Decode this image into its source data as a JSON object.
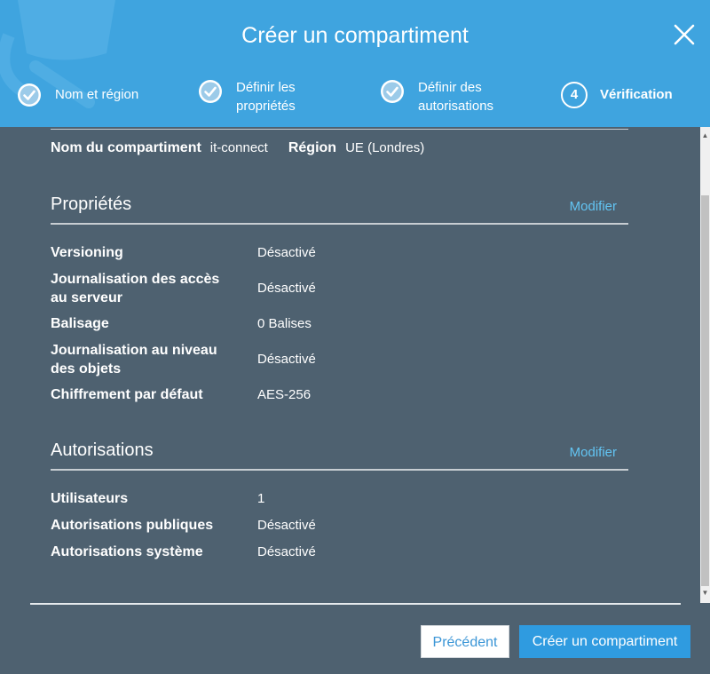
{
  "dialog": {
    "title": "Créer un compartiment",
    "close_icon": "close-icon"
  },
  "steps": [
    {
      "label_line1": "Nom et région",
      "label_line2": "",
      "state": "complete",
      "icon": "check-circle-icon"
    },
    {
      "label_line1": "Définir les",
      "label_line2": "propriétés",
      "state": "complete",
      "icon": "check-circle-icon"
    },
    {
      "label_line1": "Définir des",
      "label_line2": "autorisations",
      "state": "complete",
      "icon": "check-circle-icon"
    },
    {
      "number": "4",
      "label_line1": "Vérification",
      "label_line2": "",
      "state": "current"
    }
  ],
  "summary": {
    "bucket_name_label": "Nom du compartiment",
    "bucket_name_value": "it-connect",
    "region_label": "Région",
    "region_value": "UE (Londres)"
  },
  "properties": {
    "title": "Propriétés",
    "modify_label": "Modifier",
    "rows": [
      {
        "key_line1": "Versioning",
        "key_line2": "",
        "value": "Désactivé"
      },
      {
        "key_line1": "Journalisation des accès",
        "key_line2": "au serveur",
        "value": "Désactivé"
      },
      {
        "key_line1": "Balisage",
        "key_line2": "",
        "value": "0 Balises"
      },
      {
        "key_line1": "Journalisation au niveau",
        "key_line2": "des objets",
        "value": "Désactivé"
      },
      {
        "key_line1": "Chiffrement par défaut",
        "key_line2": "",
        "value": "AES-256"
      }
    ]
  },
  "permissions": {
    "title": "Autorisations",
    "modify_label": "Modifier",
    "rows": [
      {
        "key": "Utilisateurs",
        "value": "1"
      },
      {
        "key": "Autorisations publiques",
        "value": "Désactivé"
      },
      {
        "key": "Autorisations système",
        "value": "Désactivé"
      }
    ]
  },
  "footer": {
    "previous_label": "Précédent",
    "create_label": "Créer un compartiment"
  },
  "colors": {
    "header": "#3fa4df",
    "body": "#4e6170",
    "link": "#62c4f2",
    "primary_button": "#2f9be0"
  }
}
